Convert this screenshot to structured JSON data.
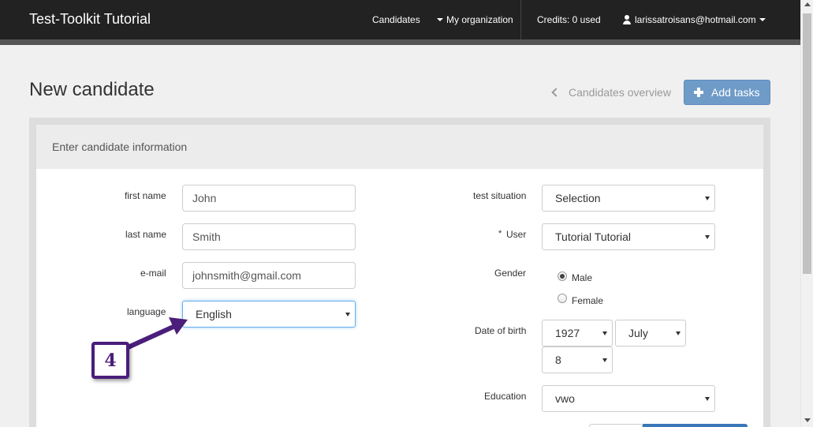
{
  "navbar": {
    "brand": "Test-Toolkit Tutorial",
    "candidates": "Candidates",
    "my_organization": "My organization",
    "credits": "Credits: 0 used",
    "user_email": "larissatroisans@hotmail.com"
  },
  "header": {
    "title": "New candidate",
    "overview_link": "Candidates overview",
    "add_tasks": "Add tasks"
  },
  "panel": {
    "heading": "Enter candidate information"
  },
  "form": {
    "first_name": {
      "label": "first name",
      "value": "John"
    },
    "last_name": {
      "label": "last name",
      "value": "Smith"
    },
    "email": {
      "label": "e-mail",
      "value": "johnsmith@gmail.com"
    },
    "language": {
      "label": "language",
      "value": "English"
    },
    "test_situation": {
      "label": "test situation",
      "value": "Selection"
    },
    "user": {
      "label": "User",
      "required_mark": "*",
      "value": "Tutorial Tutorial"
    },
    "gender": {
      "label": "Gender",
      "options": [
        "Male",
        "Female"
      ],
      "selected": "Male"
    },
    "date_of_birth": {
      "label": "Date of birth",
      "year": "1927",
      "month": "July",
      "day": "8"
    },
    "education": {
      "label": "Education",
      "value": "vwo"
    }
  },
  "annotation": {
    "step": "4",
    "color": "#4a1e7a"
  },
  "colors": {
    "navbar": "#222222",
    "primary_button": "#6f9bc9",
    "focus": "#66afe9"
  }
}
